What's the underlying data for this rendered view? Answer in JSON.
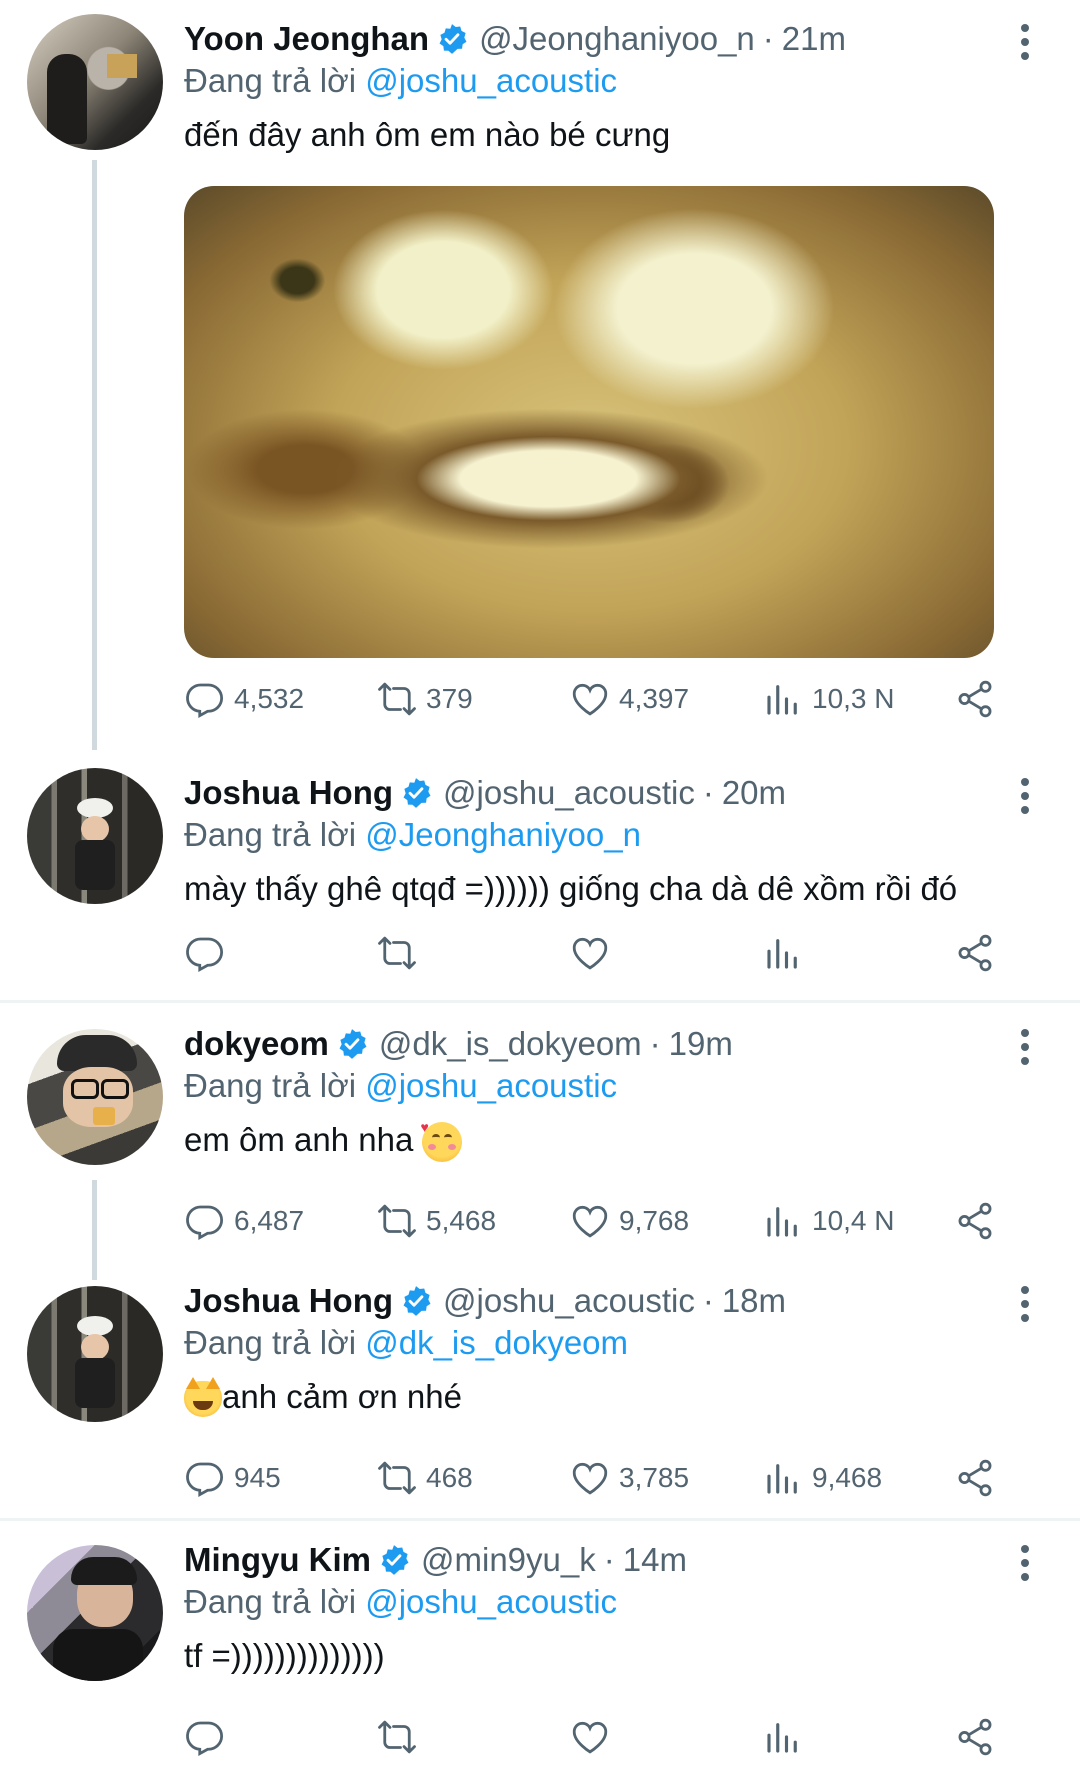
{
  "replying_prefix": "Đang trả lời",
  "tweets": [
    {
      "name": "Yoon Jeonghan",
      "handle": "@Jeonghaniyoo_n",
      "time": "21m",
      "reply_to": "@joshu_acoustic",
      "text": "đến đây anh ôm em nào bé cưng",
      "replies": "4,532",
      "retweets": "379",
      "likes": "4,397",
      "views": "10,3 N"
    },
    {
      "name": "Joshua Hong",
      "handle": "@joshu_acoustic",
      "time": "20m",
      "reply_to": "@Jeonghaniyoo_n",
      "text": "mày thấy ghê qtqđ =)))))) giống cha dà dê xồm rồi đó"
    },
    {
      "name": "dokyeom",
      "handle": "@dk_is_dokyeom",
      "time": "19m",
      "reply_to": "@joshu_acoustic",
      "text": "em ôm anh nha",
      "emoji": "smiling-face-with-hearts",
      "replies": "6,487",
      "retweets": "5,468",
      "likes": "9,768",
      "views": "10,4 N"
    },
    {
      "name": "Joshua Hong",
      "handle": "@joshu_acoustic",
      "time": "18m",
      "reply_to": "@dk_is_dokyeom",
      "text": "anh cảm ơn nhé",
      "emoji": "grinning-cat",
      "replies": "945",
      "retweets": "468",
      "likes": "3,785",
      "views": "9,468"
    },
    {
      "name": "Mingyu Kim",
      "handle": "@min9yu_k",
      "time": "14m",
      "reply_to": "@joshu_acoustic",
      "text": "tf =))))))))))))))"
    }
  ],
  "colors": {
    "link": "#1d9bf0",
    "secondary": "#536471",
    "verified": "#1d9bf0"
  }
}
